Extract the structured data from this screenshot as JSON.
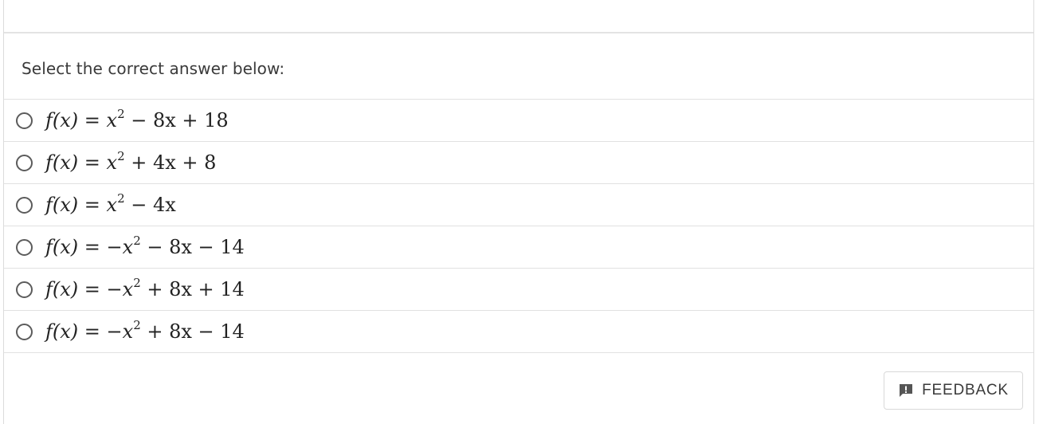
{
  "question": {
    "prompt": "Select the correct answer below:"
  },
  "options": [
    {
      "lhs": "f(x)",
      "eq": " = ",
      "sign": "",
      "base": "x",
      "exp": "2",
      "rest": " − 8x + 18"
    },
    {
      "lhs": "f(x)",
      "eq": " = ",
      "sign": "",
      "base": "x",
      "exp": "2",
      "rest": " + 4x + 8"
    },
    {
      "lhs": "f(x)",
      "eq": " = ",
      "sign": "",
      "base": "x",
      "exp": "2",
      "rest": " − 4x"
    },
    {
      "lhs": "f(x)",
      "eq": " = ",
      "sign": "−",
      "base": "x",
      "exp": "2",
      "rest": " − 8x − 14"
    },
    {
      "lhs": "f(x)",
      "eq": " = ",
      "sign": "−",
      "base": "x",
      "exp": "2",
      "rest": " + 8x + 14"
    },
    {
      "lhs": "f(x)",
      "eq": " = ",
      "sign": "−",
      "base": "x",
      "exp": "2",
      "rest": " + 8x − 14"
    }
  ],
  "feedback": {
    "label": "FEEDBACK",
    "icon": "feedback-icon"
  },
  "colors": {
    "text": "#333333",
    "border": "#e1e1e1",
    "radio": "#5b5b5b",
    "icon": "#555555"
  }
}
